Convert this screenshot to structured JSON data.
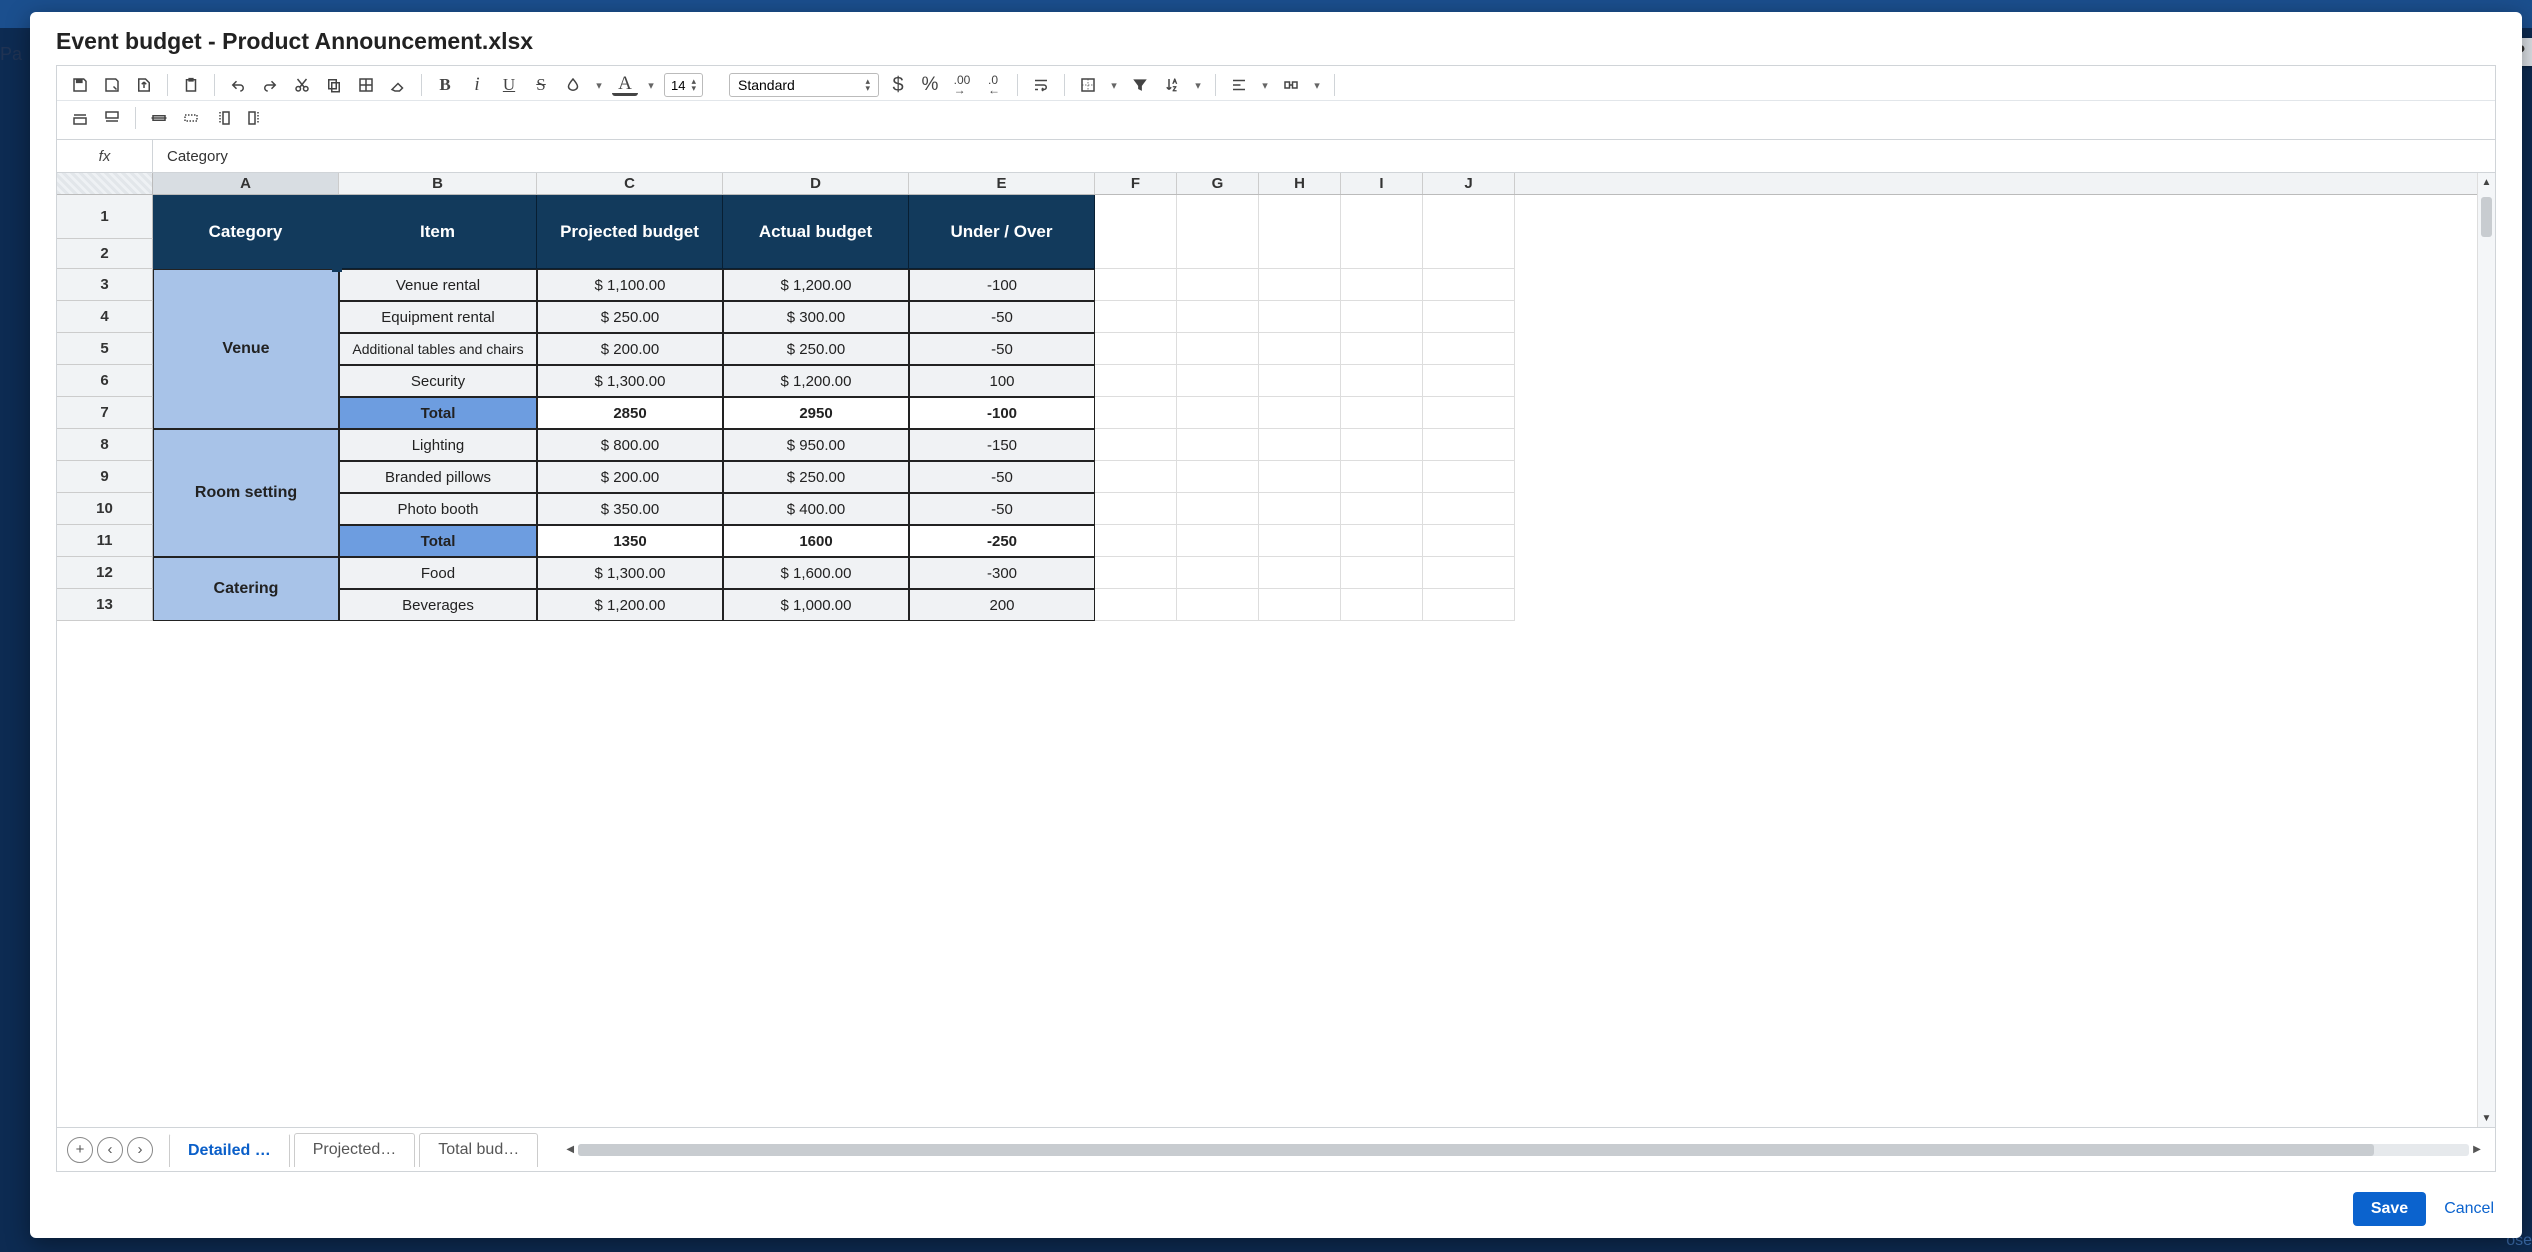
{
  "dialog_title": "Event budget - Product Announcement.xlsx",
  "toolbar": {
    "font_size": "14",
    "style": "Standard"
  },
  "fx": {
    "label": "fx",
    "value": "Category"
  },
  "columns": [
    "A",
    "B",
    "C",
    "D",
    "E",
    "F",
    "G",
    "H",
    "I",
    "J"
  ],
  "row_nums": [
    "1",
    "2",
    "3",
    "4",
    "5",
    "6",
    "7",
    "8",
    "9",
    "10",
    "11",
    "12",
    "13"
  ],
  "headers": {
    "a": "Category",
    "b": "Item",
    "c": "Projected budget",
    "d": "Actual budget",
    "e": "Under / Over"
  },
  "data": {
    "venue": {
      "label": "Venue",
      "rows": [
        {
          "item": "Venue rental",
          "proj": "$ 1,100.00",
          "act": "$ 1,200.00",
          "diff": "-100"
        },
        {
          "item": "Equipment rental",
          "proj": "$ 250.00",
          "act": "$ 300.00",
          "diff": "-50"
        },
        {
          "item": "Additional tables and chairs",
          "proj": "$ 200.00",
          "act": "$ 250.00",
          "diff": "-50"
        },
        {
          "item": "Security",
          "proj": "$ 1,300.00",
          "act": "$ 1,200.00",
          "diff": "100"
        }
      ],
      "total": {
        "item": "Total",
        "proj": "2850",
        "act": "2950",
        "diff": "-100"
      }
    },
    "room": {
      "label": "Room setting",
      "rows": [
        {
          "item": "Lighting",
          "proj": "$ 800.00",
          "act": "$ 950.00",
          "diff": "-150"
        },
        {
          "item": "Branded pillows",
          "proj": "$ 200.00",
          "act": "$ 250.00",
          "diff": "-50"
        },
        {
          "item": "Photo booth",
          "proj": "$ 350.00",
          "act": "$ 400.00",
          "diff": "-50"
        }
      ],
      "total": {
        "item": "Total",
        "proj": "1350",
        "act": "1600",
        "diff": "-250"
      }
    },
    "catering": {
      "label": "Catering",
      "rows": [
        {
          "item": "Food",
          "proj": "$ 1,300.00",
          "act": "$ 1,600.00",
          "diff": "-300"
        },
        {
          "item": "Beverages",
          "proj": "$ 1,200.00",
          "act": "$ 1,000.00",
          "diff": "200"
        }
      ]
    }
  },
  "sheets": {
    "s1": "Detailed …",
    "s2": "Projected…",
    "s3": "Total bud…"
  },
  "footer": {
    "save": "Save",
    "cancel": "Cancel"
  },
  "help": "?",
  "bg_left": "Pa",
  "bg_right": "ose"
}
